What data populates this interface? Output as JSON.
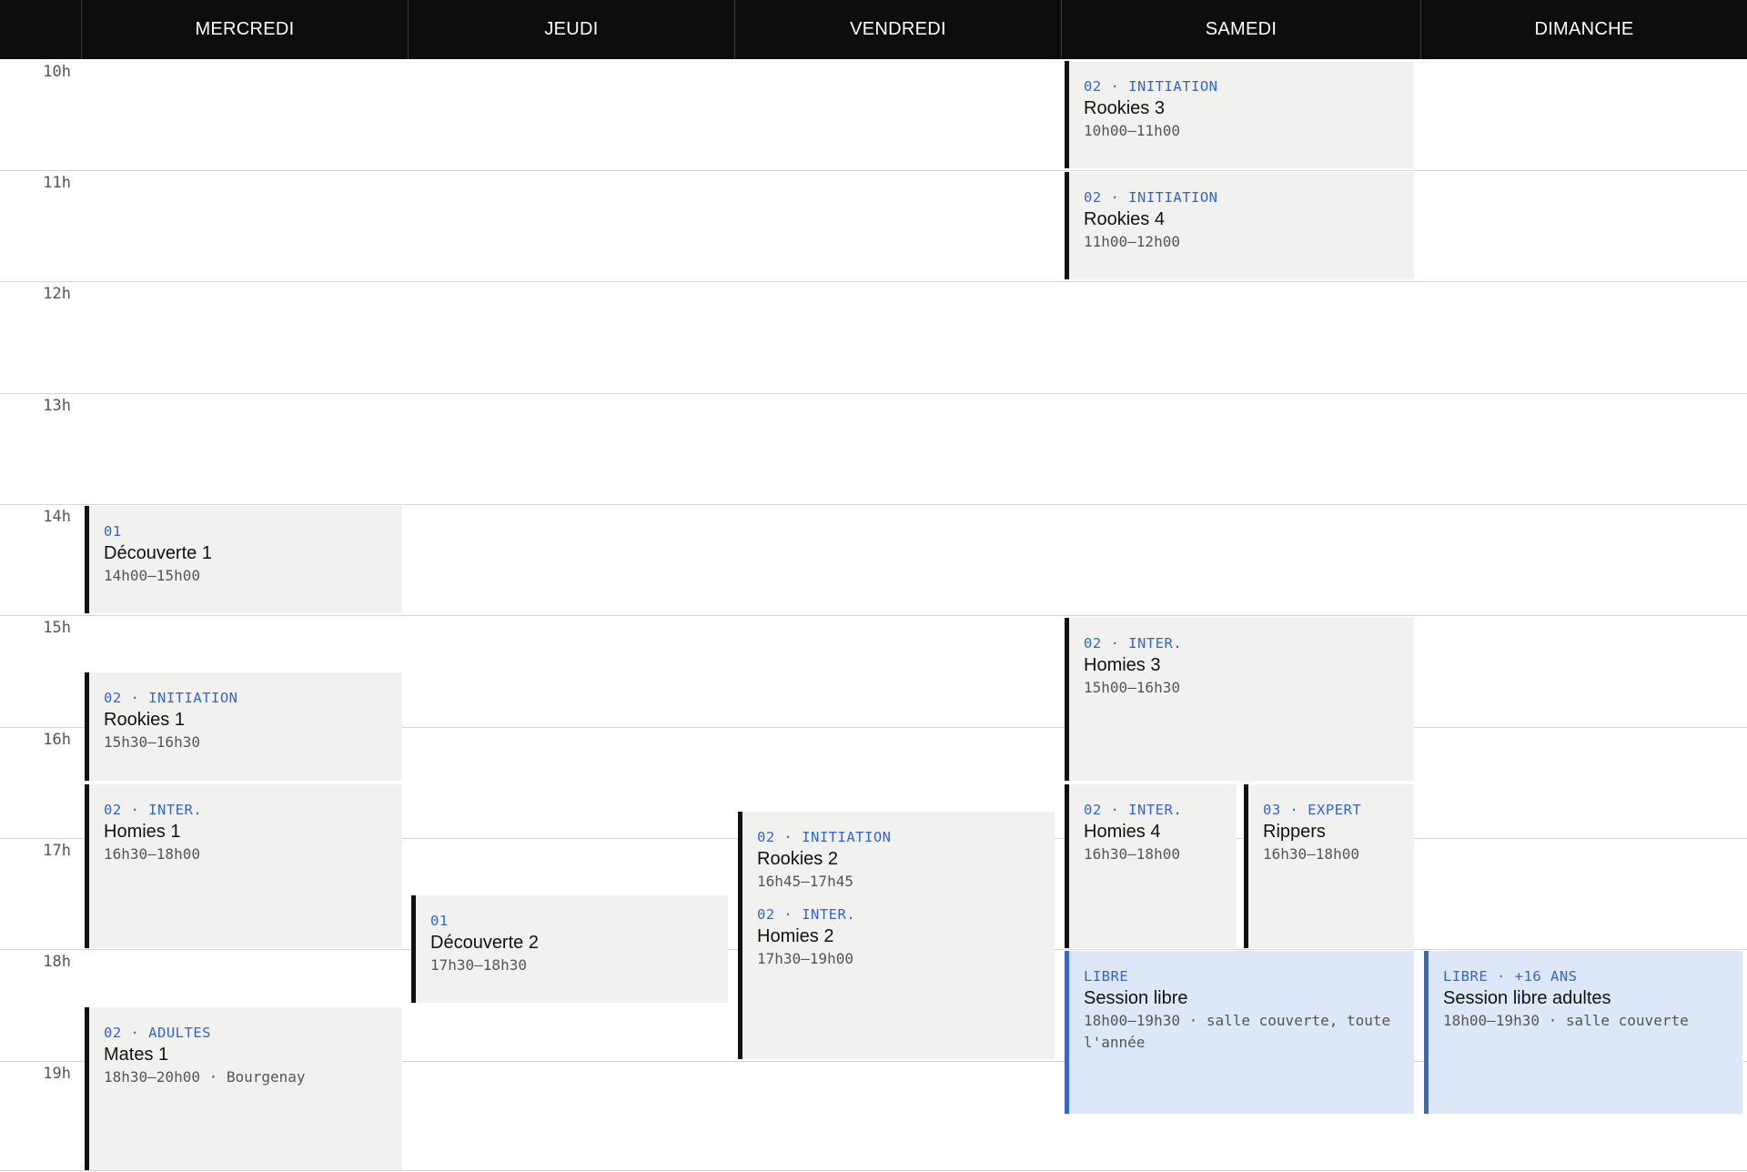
{
  "days": [
    "MERCREDI",
    "JEUDI",
    "VENDREDI",
    "SAMEDI",
    "DIMANCHE"
  ],
  "hours": [
    "10h",
    "11h",
    "12h",
    "13h",
    "14h",
    "15h",
    "16h",
    "17h",
    "18h",
    "19h"
  ],
  "events": {
    "sam_rookies3": {
      "tag": "02 · INITIATION",
      "title": "Rookies 3",
      "time": "10h00–11h00"
    },
    "sam_rookies4": {
      "tag": "02 · INITIATION",
      "title": "Rookies 4",
      "time": "11h00–12h00"
    },
    "mer_decouverte1": {
      "tag": "01",
      "title": "Découverte 1",
      "time": "14h00–15h00"
    },
    "sam_homies3": {
      "tag": "02 · INTER.",
      "title": "Homies 3",
      "time": "15h00–16h30"
    },
    "mer_rookies1": {
      "tag": "02 · INITIATION",
      "title": "Rookies 1",
      "time": "15h30–16h30"
    },
    "mer_homies1": {
      "tag": "02 · INTER.",
      "title": "Homies 1",
      "time": "16h30–18h00"
    },
    "sam_homies4": {
      "tag": "02 · INTER.",
      "title": "Homies 4",
      "time": "16h30–18h00"
    },
    "sam_rippers": {
      "tag": "03 · EXPERT",
      "title": "Rippers",
      "time": "16h30–18h00"
    },
    "ven_rookies2": {
      "tag": "02 · INITIATION",
      "title": "Rookies 2",
      "time": "16h45–17h45"
    },
    "ven_homies2": {
      "tag": "02 · INTER.",
      "title": "Homies 2",
      "time": "17h30–19h00"
    },
    "jeu_decouverte2": {
      "tag": "01",
      "title": "Découverte 2",
      "time": "17h30–18h30"
    },
    "sam_session_libre": {
      "tag": "LIBRE",
      "title": "Session libre",
      "time": "18h00–19h30 · salle couverte, toute l'année"
    },
    "dim_session_libre_adultes": {
      "tag": "LIBRE · +16 ANS",
      "title": "Session libre adultes",
      "time": "18h00–19h30 · salle couverte"
    },
    "mer_mates1": {
      "tag": "02 · ADULTES",
      "title": "Mates 1",
      "time": "18h30–20h00 · Bourgenay"
    }
  },
  "colors": {
    "header_bg": "#0d0d0d",
    "event_bg": "#f1f1f0",
    "event_border": "#111111",
    "libre_bg": "#dce8f8",
    "libre_border": "#3568c7",
    "tag_color": "#3366cc"
  }
}
